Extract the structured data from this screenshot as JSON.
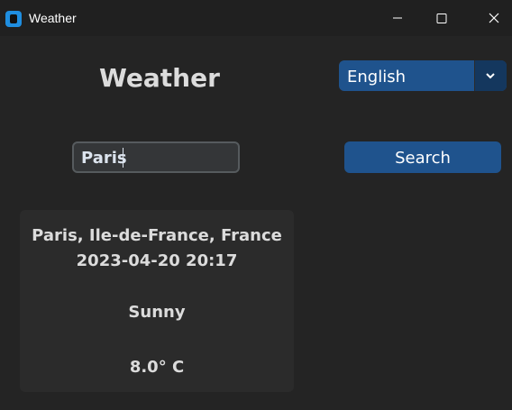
{
  "window": {
    "title": "Weather",
    "icon": "app-icon"
  },
  "header": {
    "heading": "Weather"
  },
  "language": {
    "selected": "English"
  },
  "search": {
    "input_value": "Paris",
    "button_label": "Search"
  },
  "result": {
    "location": "Paris, Ile-de-France, France",
    "datetime": "2023-04-20 20:17",
    "condition": "Sunny",
    "temperature": "8.0° C"
  },
  "colors": {
    "background": "#242424",
    "accent": "#1f538d",
    "accent_dark": "#14375e",
    "card": "#2b2b2b",
    "text": "#dcdcdc"
  }
}
